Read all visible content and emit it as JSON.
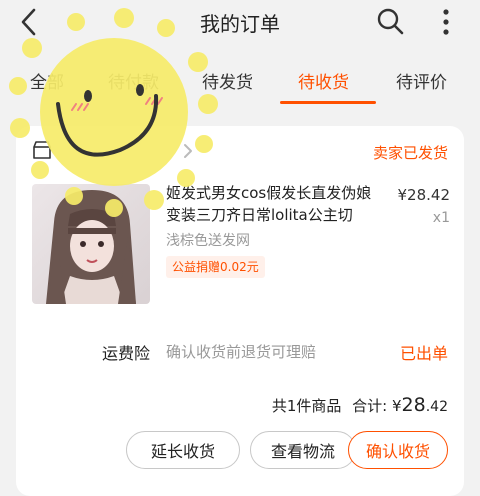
{
  "header": {
    "title": "我的订单",
    "back_icon": "back-arrow-icon",
    "search_icon": "search-icon",
    "more_icon": "more-vertical-icon"
  },
  "tabs": [
    {
      "label": "全部",
      "active": false
    },
    {
      "label": "待付款",
      "active": false
    },
    {
      "label": "待发货",
      "active": false
    },
    {
      "label": "待收货",
      "active": true
    },
    {
      "label": "待评价",
      "active": false
    }
  ],
  "order": {
    "status": "卖家已发货",
    "product": {
      "name": "姬发式男女cos假发长直发伪娘变装三刀齐日常lolita公主切",
      "variant": "浅棕色送发网",
      "price": "¥28.42",
      "quantity": "x1",
      "charity": "公益捐赠0.02元"
    },
    "insurance": {
      "label": "运费险",
      "description": "确认收货前退货可理赔",
      "status": "已出单"
    },
    "summary": {
      "count_text": "共1件商品",
      "total_label": "合计:",
      "currency": "¥",
      "amount_int": "28",
      "amount_dec": ".42"
    },
    "actions": {
      "extend": "延长收货",
      "logistics": "查看物流",
      "confirm": "确认收货"
    }
  },
  "colors": {
    "accent": "#ff5000",
    "background": "#f2f2f2",
    "card": "#ffffff",
    "sticker": "#f7ec6a"
  }
}
